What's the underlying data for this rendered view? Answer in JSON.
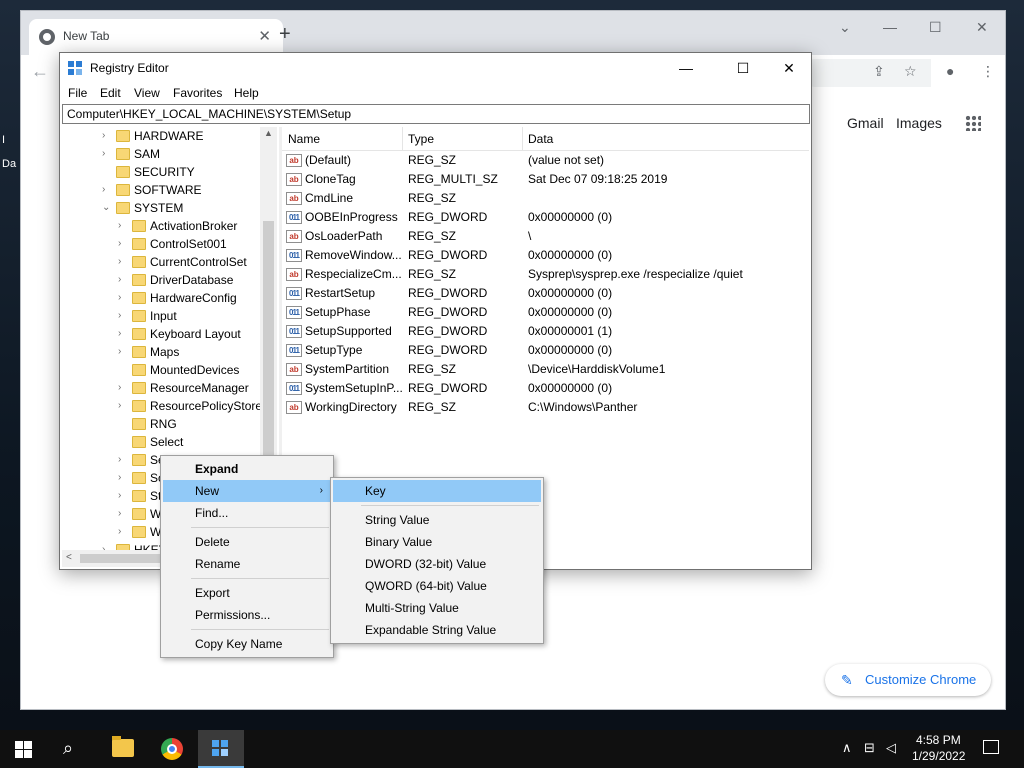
{
  "desktop": {
    "edge_text": [
      "I",
      "Da"
    ]
  },
  "chrome": {
    "tab_title": "New Tab",
    "tab_close": "✕",
    "new_tab": "+",
    "window_controls": {
      "tab_search": "⌄",
      "minimize": "—",
      "maximize": "☐",
      "close": "✕"
    },
    "back": "←",
    "omnibox_icons": {
      "share": "⇪",
      "bookmark": "☆",
      "profile": "●",
      "menu": "⋮"
    },
    "gmail": "Gmail",
    "images": "Images",
    "customize_chrome": "Customize Chrome",
    "customize_icon": "✎"
  },
  "regedit": {
    "title": "Registry Editor",
    "window_controls": {
      "minimize": "—",
      "maximize": "☐",
      "close": "✕"
    },
    "menu": [
      "File",
      "Edit",
      "View",
      "Favorites",
      "Help"
    ],
    "address": "Computer\\HKEY_LOCAL_MACHINE\\SYSTEM\\Setup",
    "tree": [
      {
        "label": "HARDWARE",
        "toggle": "›"
      },
      {
        "label": "SAM",
        "toggle": "›"
      },
      {
        "label": "SECURITY",
        "toggle": ""
      },
      {
        "label": "SOFTWARE",
        "toggle": "›"
      },
      {
        "label": "SYSTEM",
        "toggle": "⌄"
      },
      {
        "label": "ActivationBroker",
        "toggle": "›"
      },
      {
        "label": "ControlSet001",
        "toggle": "›"
      },
      {
        "label": "CurrentControlSet",
        "toggle": "›"
      },
      {
        "label": "DriverDatabase",
        "toggle": "›"
      },
      {
        "label": "HardwareConfig",
        "toggle": "›"
      },
      {
        "label": "Input",
        "toggle": "›"
      },
      {
        "label": "Keyboard Layout",
        "toggle": "›"
      },
      {
        "label": "Maps",
        "toggle": "›"
      },
      {
        "label": "MountedDevices",
        "toggle": ""
      },
      {
        "label": "ResourceManager",
        "toggle": "›"
      },
      {
        "label": "ResourcePolicyStore",
        "toggle": "›"
      },
      {
        "label": "RNG",
        "toggle": ""
      },
      {
        "label": "Select",
        "toggle": ""
      },
      {
        "label": "Se",
        "toggle": "›"
      },
      {
        "label": "So",
        "toggle": "›"
      },
      {
        "label": "St",
        "toggle": "›"
      },
      {
        "label": "W",
        "toggle": "›"
      },
      {
        "label": "W",
        "toggle": "›"
      },
      {
        "label": "HKEY_U",
        "toggle": "›"
      }
    ],
    "scroll_arrows": {
      "up": "▲",
      "left": "<"
    },
    "columns": {
      "name": "Name",
      "type": "Type",
      "data": "Data"
    },
    "values": [
      {
        "icon": "ab",
        "name": "(Default)",
        "type": "REG_SZ",
        "data": "(value not set)"
      },
      {
        "icon": "ab",
        "name": "CloneTag",
        "type": "REG_MULTI_SZ",
        "data": "Sat Dec 07 09:18:25 2019"
      },
      {
        "icon": "ab",
        "name": "CmdLine",
        "type": "REG_SZ",
        "data": ""
      },
      {
        "icon": "011",
        "name": "OOBEInProgress",
        "type": "REG_DWORD",
        "data": "0x00000000 (0)"
      },
      {
        "icon": "ab",
        "name": "OsLoaderPath",
        "type": "REG_SZ",
        "data": "\\"
      },
      {
        "icon": "011",
        "name": "RemoveWindow...",
        "type": "REG_DWORD",
        "data": "0x00000000 (0)"
      },
      {
        "icon": "ab",
        "name": "RespecializeCm...",
        "type": "REG_SZ",
        "data": "Sysprep\\sysprep.exe /respecialize /quiet"
      },
      {
        "icon": "011",
        "name": "RestartSetup",
        "type": "REG_DWORD",
        "data": "0x00000000 (0)"
      },
      {
        "icon": "011",
        "name": "SetupPhase",
        "type": "REG_DWORD",
        "data": "0x00000000 (0)"
      },
      {
        "icon": "011",
        "name": "SetupSupported",
        "type": "REG_DWORD",
        "data": "0x00000001 (1)"
      },
      {
        "icon": "011",
        "name": "SetupType",
        "type": "REG_DWORD",
        "data": "0x00000000 (0)"
      },
      {
        "icon": "ab",
        "name": "SystemPartition",
        "type": "REG_SZ",
        "data": "\\Device\\HarddiskVolume1"
      },
      {
        "icon": "011",
        "name": "SystemSetupInP...",
        "type": "REG_DWORD",
        "data": "0x00000000 (0)"
      },
      {
        "icon": "ab",
        "name": "WorkingDirectory",
        "type": "REG_SZ",
        "data": "C:\\Windows\\Panther"
      }
    ]
  },
  "context_menu": {
    "items": [
      "Expand",
      "New",
      "Find...",
      "Delete",
      "Rename",
      "Export",
      "Permissions...",
      "Copy Key Name"
    ],
    "submenu_arrow": "›"
  },
  "submenu_new": {
    "items": [
      "Key",
      "String Value",
      "Binary Value",
      "DWORD (32-bit) Value",
      "QWORD (64-bit) Value",
      "Multi-String Value",
      "Expandable String Value"
    ]
  },
  "taskbar": {
    "search_icon": "⌕",
    "tray": {
      "chevron": "∧",
      "network": "⊟",
      "volume": "◁"
    },
    "time": "4:58 PM",
    "date": "1/29/2022"
  },
  "colors": {
    "highlight": "#91c9f7",
    "link_blue": "#1a73e8",
    "folder": "#f8d775"
  }
}
